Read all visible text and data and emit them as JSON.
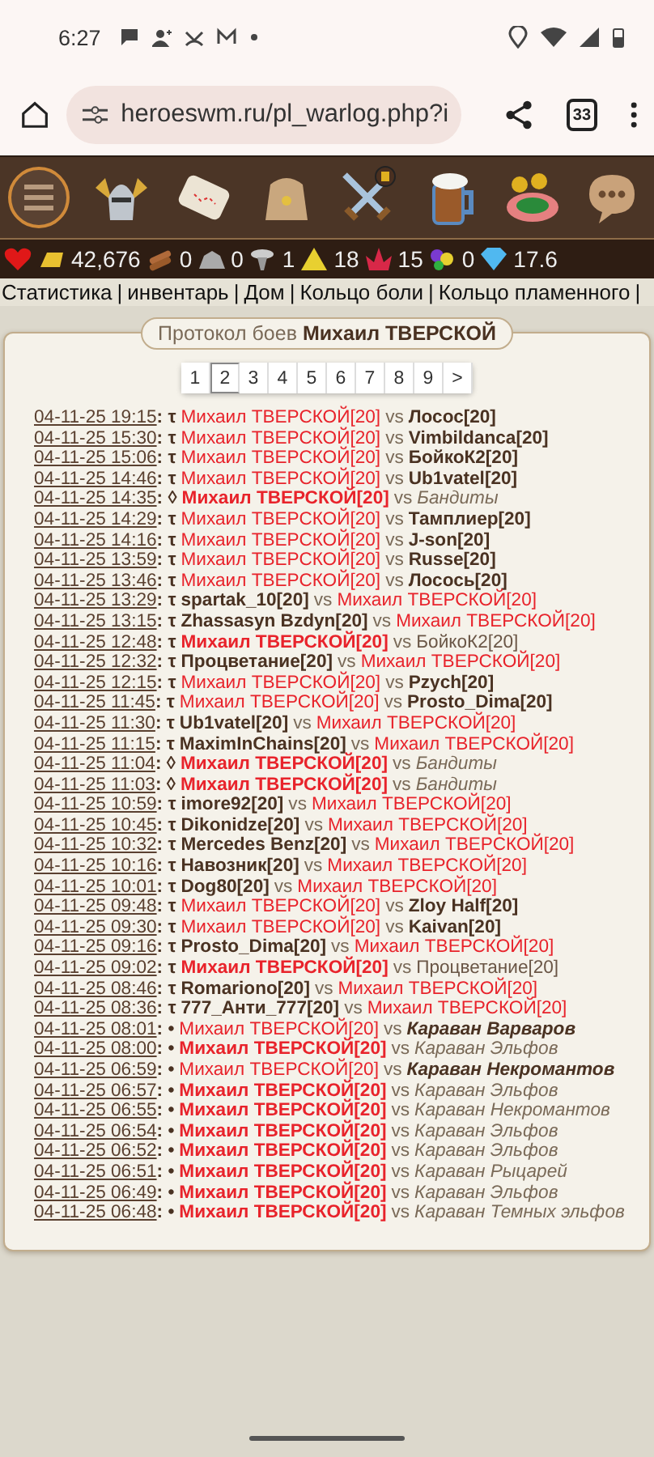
{
  "status_bar": {
    "time": "6:27"
  },
  "browser": {
    "url": "heroeswm.ru/pl_warlog.php?i",
    "tab_count": "33"
  },
  "nav_icons": [
    {
      "kind": "menu"
    },
    {
      "kind": "helmet"
    },
    {
      "kind": "map"
    },
    {
      "kind": "bag"
    },
    {
      "kind": "swords"
    },
    {
      "kind": "mug"
    },
    {
      "kind": "roulette"
    },
    {
      "kind": "chat"
    }
  ],
  "resources": [
    {
      "kind": "heart"
    },
    {
      "kind": "gold",
      "value": "42,676"
    },
    {
      "kind": "wood",
      "value": "0"
    },
    {
      "kind": "ore",
      "value": "0"
    },
    {
      "kind": "mercury",
      "value": "1"
    },
    {
      "kind": "sulfur",
      "value": "18"
    },
    {
      "kind": "crystal",
      "value": "15"
    },
    {
      "kind": "gems",
      "value": "0"
    },
    {
      "kind": "diamond",
      "value": "17.6"
    }
  ],
  "links": {
    "items": [
      "Статистика",
      "инвентарь",
      "Дом",
      "Кольцо боли",
      "Кольцо пламенного"
    ],
    "separator": "|"
  },
  "panel": {
    "title": "Протокол боев **Михаил ТВЕРСКОЙ**",
    "pages": [
      {
        "label": "1",
        "selected": false
      },
      {
        "label": "2",
        "selected": true
      },
      {
        "label": "3",
        "selected": false
      },
      {
        "label": "4",
        "selected": false
      },
      {
        "label": "5",
        "selected": false
      },
      {
        "label": "6",
        "selected": false
      },
      {
        "label": "7",
        "selected": false
      },
      {
        "label": "8",
        "selected": false
      },
      {
        "label": "9",
        "selected": false
      },
      {
        "label": ">",
        "selected": false
      }
    ],
    "battles": [
      {
        "time": "04-11-25 19:15",
        "mark": ": τ",
        "left": {
          "text": "Михаил ТВЕРСКОЙ[20]",
          "kind": "self"
        },
        "vs": "vs",
        "right": {
          "text": "Лосос[20]",
          "kind": "player_won"
        }
      },
      {
        "time": "04-11-25 15:30",
        "mark": ": τ",
        "left": {
          "text": "Михаил ТВЕРСКОЙ[20]",
          "kind": "self"
        },
        "vs": "vs",
        "right": {
          "text": "Vimbildanca[20]",
          "kind": "player_won"
        }
      },
      {
        "time": "04-11-25 15:06",
        "mark": ": τ",
        "left": {
          "text": "Михаил ТВЕРСКОЙ[20]",
          "kind": "self"
        },
        "vs": "vs",
        "right": {
          "text": "БойкоК2[20]",
          "kind": "player_won"
        }
      },
      {
        "time": "04-11-25 14:46",
        "mark": ": τ",
        "left": {
          "text": "Михаил ТВЕРСКОЙ[20]",
          "kind": "self"
        },
        "vs": "vs",
        "right": {
          "text": "Ub1vatel[20]",
          "kind": "player_won"
        }
      },
      {
        "time": "04-11-25 14:35",
        "mark": ": ◊",
        "left": {
          "text": "Михаил ТВЕРСКОЙ[20]",
          "kind": "self_won"
        },
        "vs": "vs",
        "right": {
          "text": "Бандиты",
          "kind": "npc"
        }
      },
      {
        "time": "04-11-25 14:29",
        "mark": ": τ",
        "left": {
          "text": "Михаил ТВЕРСКОЙ[20]",
          "kind": "self"
        },
        "vs": "vs",
        "right": {
          "text": "Тамплиер[20]",
          "kind": "player_won"
        }
      },
      {
        "time": "04-11-25 14:16",
        "mark": ": τ",
        "left": {
          "text": "Михаил ТВЕРСКОЙ[20]",
          "kind": "self"
        },
        "vs": "vs",
        "right": {
          "text": "J-son[20]",
          "kind": "player_won"
        }
      },
      {
        "time": "04-11-25 13:59",
        "mark": ": τ",
        "left": {
          "text": "Михаил ТВЕРСКОЙ[20]",
          "kind": "self"
        },
        "vs": "vs",
        "right": {
          "text": "Russe[20]",
          "kind": "player_won"
        }
      },
      {
        "time": "04-11-25 13:46",
        "mark": ": τ",
        "left": {
          "text": "Михаил ТВЕРСКОЙ[20]",
          "kind": "self"
        },
        "vs": "vs",
        "right": {
          "text": "Лосось[20]",
          "kind": "player_won"
        }
      },
      {
        "time": "04-11-25 13:29",
        "mark": ": τ",
        "left": {
          "text": "spartak_10[20]",
          "kind": "player_won"
        },
        "vs": "vs",
        "right": {
          "text": "Михаил ТВЕРСКОЙ[20]",
          "kind": "self"
        }
      },
      {
        "time": "04-11-25 13:15",
        "mark": ": τ",
        "left": {
          "text": "Zhassasyn Bzdyn[20]",
          "kind": "player_won"
        },
        "vs": "vs",
        "right": {
          "text": "Михаил ТВЕРСКОЙ[20]",
          "kind": "self"
        }
      },
      {
        "time": "04-11-25 12:48",
        "mark": ": τ",
        "left": {
          "text": "Михаил ТВЕРСКОЙ[20]",
          "kind": "self_won"
        },
        "vs": "vs",
        "right": {
          "text": "БойкоК2[20]",
          "kind": "player"
        }
      },
      {
        "time": "04-11-25 12:32",
        "mark": ": τ",
        "left": {
          "text": "Процветание[20]",
          "kind": "player_won"
        },
        "vs": "vs",
        "right": {
          "text": "Михаил ТВЕРСКОЙ[20]",
          "kind": "self"
        }
      },
      {
        "time": "04-11-25 12:15",
        "mark": ": τ",
        "left": {
          "text": "Михаил ТВЕРСКОЙ[20]",
          "kind": "self"
        },
        "vs": "vs",
        "right": {
          "text": "Pzych[20]",
          "kind": "player_won"
        }
      },
      {
        "time": "04-11-25 11:45",
        "mark": ": τ",
        "left": {
          "text": "Михаил ТВЕРСКОЙ[20]",
          "kind": "self"
        },
        "vs": "vs",
        "right": {
          "text": "Prosto_Dima[20]",
          "kind": "player_won"
        }
      },
      {
        "time": "04-11-25 11:30",
        "mark": ": τ",
        "left": {
          "text": "Ub1vatel[20]",
          "kind": "player_won"
        },
        "vs": "vs",
        "right": {
          "text": "Михаил ТВЕРСКОЙ[20]",
          "kind": "self"
        }
      },
      {
        "time": "04-11-25 11:15",
        "mark": ": τ",
        "left": {
          "text": "MaximInChains[20]",
          "kind": "player_won"
        },
        "vs": "vs",
        "right": {
          "text": "Михаил ТВЕРСКОЙ[20]",
          "kind": "self"
        }
      },
      {
        "time": "04-11-25 11:04",
        "mark": ": ◊",
        "left": {
          "text": "Михаил ТВЕРСКОЙ[20]",
          "kind": "self_won"
        },
        "vs": "vs",
        "right": {
          "text": "Бандиты",
          "kind": "npc"
        }
      },
      {
        "time": "04-11-25 11:03",
        "mark": ": ◊",
        "left": {
          "text": "Михаил ТВЕРСКОЙ[20]",
          "kind": "self_won"
        },
        "vs": "vs",
        "right": {
          "text": "Бандиты",
          "kind": "npc"
        }
      },
      {
        "time": "04-11-25 10:59",
        "mark": ": τ",
        "left": {
          "text": "imore92[20]",
          "kind": "player_won"
        },
        "vs": "vs",
        "right": {
          "text": "Михаил ТВЕРСКОЙ[20]",
          "kind": "self"
        }
      },
      {
        "time": "04-11-25 10:45",
        "mark": ": τ",
        "left": {
          "text": "Dikonidze[20]",
          "kind": "player_won"
        },
        "vs": "vs",
        "right": {
          "text": "Михаил ТВЕРСКОЙ[20]",
          "kind": "self"
        }
      },
      {
        "time": "04-11-25 10:32",
        "mark": ": τ",
        "left": {
          "text": "Mercedes Benz[20]",
          "kind": "player_won"
        },
        "vs": "vs",
        "right": {
          "text": "Михаил ТВЕРСКОЙ[20]",
          "kind": "self"
        }
      },
      {
        "time": "04-11-25 10:16",
        "mark": ": τ",
        "left": {
          "text": "Навозник[20]",
          "kind": "player_won"
        },
        "vs": "vs",
        "right": {
          "text": "Михаил ТВЕРСКОЙ[20]",
          "kind": "self"
        }
      },
      {
        "time": "04-11-25 10:01",
        "mark": ": τ",
        "left": {
          "text": "Dog80[20]",
          "kind": "player_won"
        },
        "vs": "vs",
        "right": {
          "text": "Михаил ТВЕРСКОЙ[20]",
          "kind": "self"
        }
      },
      {
        "time": "04-11-25 09:48",
        "mark": ": τ",
        "left": {
          "text": "Михаил ТВЕРСКОЙ[20]",
          "kind": "self"
        },
        "vs": "vs",
        "right": {
          "text": "Zloy Half[20]",
          "kind": "player_won"
        }
      },
      {
        "time": "04-11-25 09:30",
        "mark": ": τ",
        "left": {
          "text": "Михаил ТВЕРСКОЙ[20]",
          "kind": "self"
        },
        "vs": "vs",
        "right": {
          "text": "Kaivan[20]",
          "kind": "player_won"
        }
      },
      {
        "time": "04-11-25 09:16",
        "mark": ": τ",
        "left": {
          "text": "Prosto_Dima[20]",
          "kind": "player_won"
        },
        "vs": "vs",
        "right": {
          "text": "Михаил ТВЕРСКОЙ[20]",
          "kind": "self"
        }
      },
      {
        "time": "04-11-25 09:02",
        "mark": ": τ",
        "left": {
          "text": "Михаил ТВЕРСКОЙ[20]",
          "kind": "self_won"
        },
        "vs": "vs",
        "right": {
          "text": "Процветание[20]",
          "kind": "player"
        }
      },
      {
        "time": "04-11-25 08:46",
        "mark": ": τ",
        "left": {
          "text": "Romariono[20]",
          "kind": "player_won"
        },
        "vs": "vs",
        "right": {
          "text": "Михаил ТВЕРСКОЙ[20]",
          "kind": "self"
        }
      },
      {
        "time": "04-11-25 08:36",
        "mark": ": τ",
        "left": {
          "text": "777_Анти_777[20]",
          "kind": "player_won"
        },
        "vs": "vs",
        "right": {
          "text": "Михаил ТВЕРСКОЙ[20]",
          "kind": "self"
        }
      },
      {
        "time": "04-11-25 08:01",
        "mark": ": •",
        "left": {
          "text": "Михаил ТВЕРСКОЙ[20]",
          "kind": "self"
        },
        "vs": "vs",
        "right": {
          "text": "Караван Варваров",
          "kind": "npc_won"
        }
      },
      {
        "time": "04-11-25 08:00",
        "mark": ": •",
        "left": {
          "text": "Михаил ТВЕРСКОЙ[20]",
          "kind": "self_won"
        },
        "vs": "vs",
        "right": {
          "text": "Караван Эльфов",
          "kind": "npc"
        }
      },
      {
        "time": "04-11-25 06:59",
        "mark": ": •",
        "left": {
          "text": "Михаил ТВЕРСКОЙ[20]",
          "kind": "self"
        },
        "vs": "vs",
        "right": {
          "text": "Караван Некромантов",
          "kind": "npc_won"
        }
      },
      {
        "time": "04-11-25 06:57",
        "mark": ": •",
        "left": {
          "text": "Михаил ТВЕРСКОЙ[20]",
          "kind": "self_won"
        },
        "vs": "vs",
        "right": {
          "text": "Караван Эльфов",
          "kind": "npc"
        }
      },
      {
        "time": "04-11-25 06:55",
        "mark": ": •",
        "left": {
          "text": "Михаил ТВЕРСКОЙ[20]",
          "kind": "self_won"
        },
        "vs": "vs",
        "right": {
          "text": "Караван Некромантов",
          "kind": "npc"
        }
      },
      {
        "time": "04-11-25 06:54",
        "mark": ": •",
        "left": {
          "text": "Михаил ТВЕРСКОЙ[20]",
          "kind": "self_won"
        },
        "vs": "vs",
        "right": {
          "text": "Караван Эльфов",
          "kind": "npc"
        }
      },
      {
        "time": "04-11-25 06:52",
        "mark": ": •",
        "left": {
          "text": "Михаил ТВЕРСКОЙ[20]",
          "kind": "self_won"
        },
        "vs": "vs",
        "right": {
          "text": "Караван Эльфов",
          "kind": "npc"
        }
      },
      {
        "time": "04-11-25 06:51",
        "mark": ": •",
        "left": {
          "text": "Михаил ТВЕРСКОЙ[20]",
          "kind": "self_won"
        },
        "vs": "vs",
        "right": {
          "text": "Караван Рыцарей",
          "kind": "npc"
        }
      },
      {
        "time": "04-11-25 06:49",
        "mark": ": •",
        "left": {
          "text": "Михаил ТВЕРСКОЙ[20]",
          "kind": "self_won"
        },
        "vs": "vs",
        "right": {
          "text": "Караван Эльфов",
          "kind": "npc"
        }
      },
      {
        "time": "04-11-25 06:48",
        "mark": ": •",
        "left": {
          "text": "Михаил ТВЕРСКОЙ[20]",
          "kind": "self_won"
        },
        "vs": "vs",
        "right": {
          "text": "Караван Темных эльфов",
          "kind": "npc"
        }
      }
    ]
  }
}
